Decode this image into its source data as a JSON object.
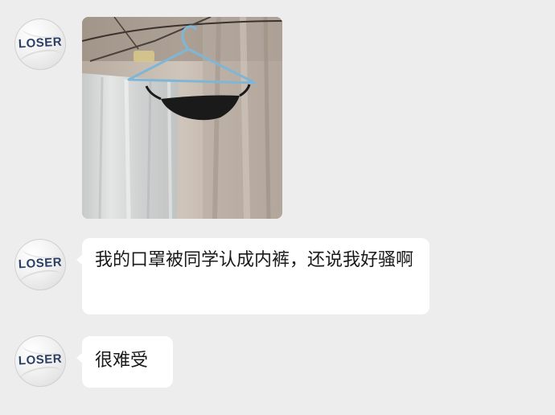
{
  "messages": [
    {
      "avatar": {
        "label": "LOSER",
        "icon": "loser-avatar-icon"
      },
      "type": "image",
      "image": {
        "description_icon": "hanger-photo",
        "colors": {
          "hanger": "#7fb6d6",
          "garment": "#1a1a1a",
          "curtain": "#d6d8d8",
          "wall": "#c9bdb2"
        }
      }
    },
    {
      "avatar": {
        "label": "LOSER",
        "icon": "loser-avatar-icon"
      },
      "type": "text",
      "text": "我的口罩被同学认成内裤，还说我好骚啊"
    },
    {
      "avatar": {
        "label": "LOSER",
        "icon": "loser-avatar-icon"
      },
      "type": "text",
      "text": "很难受"
    }
  ],
  "theme": {
    "background": "#ededed",
    "bubble": "#ffffff",
    "avatar_text": "#2a3f66"
  }
}
